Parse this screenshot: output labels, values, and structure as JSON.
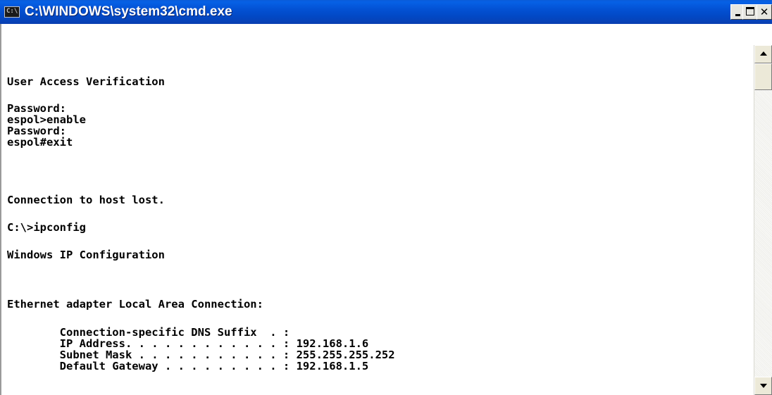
{
  "window": {
    "title": "C:\\WINDOWS\\system32\\cmd.exe",
    "icon_label": "C:\\",
    "icon": "cmd-prompt-icon",
    "title_color": "#ffffff",
    "titlebar_color": "#0351d3"
  },
  "controls": {
    "minimize_icon": "minimize-icon",
    "maximize_icon": "maximize-icon",
    "close_icon": "close-icon",
    "close_glyph": "✕"
  },
  "console": {
    "text_color": "#000000",
    "background_color": "#ffffff",
    "lines": [
      "User Access Verification",
      "Password:",
      "espol>enable",
      "Password:",
      "espol#exit",
      "Connection to host lost.",
      "C:\\>ipconfig",
      "Windows IP Configuration",
      "Ethernet adapter Local Area Connection:",
      "        Connection-specific DNS Suffix  . :",
      "        IP Address. . . . . . . . . . . . : 192.168.1.6",
      "        Subnet Mask . . . . . . . . . . . : 255.255.255.252",
      "        Default Gateway . . . . . . . . . : 192.168.1.5"
    ]
  },
  "scrollbar": {
    "up_icon": "scroll-up-arrow-icon",
    "down_icon": "scroll-down-arrow-icon"
  }
}
